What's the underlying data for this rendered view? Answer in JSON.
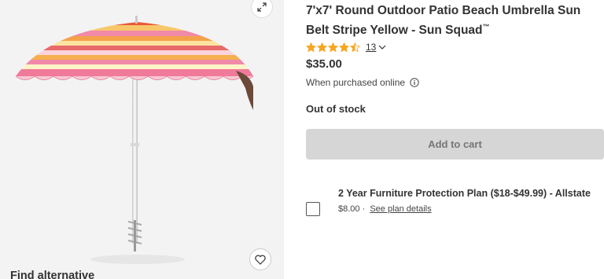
{
  "product": {
    "title": "7'x7' Round Outdoor Patio Beach Umbrella Sun Belt Stripe Yellow - Sun Squad",
    "trademark": "™",
    "rating_value": 4.5,
    "rating_count": "13",
    "price": "$35.00",
    "purchase_note": "When purchased online",
    "stock_status": "Out of stock",
    "add_to_cart_label": "Add to cart"
  },
  "protection_plan": {
    "title": "2 Year Furniture Protection Plan ($18-$49.99) - Allstate",
    "price": "$8.00",
    "separator": "·",
    "details_link": "See plan details"
  },
  "find_alternative": "Find alternative",
  "icons": {
    "expand": "expand-icon",
    "favorite": "heart-icon",
    "info": "info-icon",
    "rating_dropdown": "chevron-down-icon",
    "star": "star-icon"
  },
  "colors": {
    "star": "#f5a623",
    "cart_button_bg": "#d6d6d6",
    "cart_button_text": "#767676",
    "image_bg": "#f3f3f3"
  }
}
